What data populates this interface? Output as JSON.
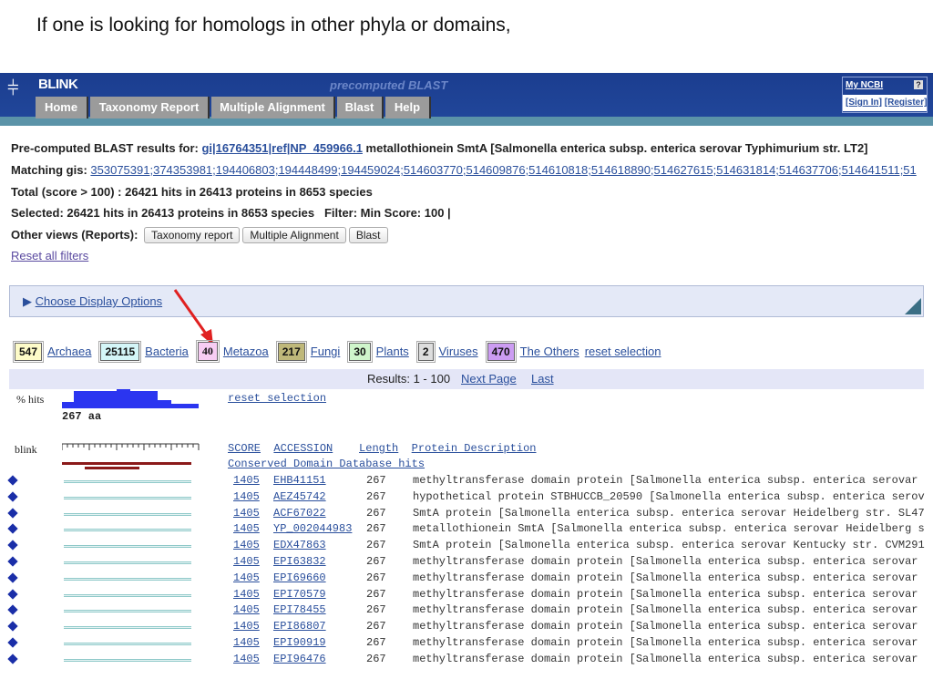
{
  "slide_title": "If one is looking for homologs in other phyla or domains,",
  "header": {
    "brand": "BLINK",
    "subtitle": "precomputed BLAST",
    "tabs": [
      "Home",
      "Taxonomy Report",
      "Multiple Alignment",
      "Blast",
      "Help"
    ],
    "my_ncbi": "My NCBI",
    "help_icon": "?",
    "sign_in": "[Sign In]",
    "register": "[Register]"
  },
  "summary": {
    "pre_label": "Pre-computed BLAST results for:",
    "query_link": "gi|16764351|ref|NP_459966.1",
    "query_desc": "metallothionein SmtA [Salmonella enterica subsp. enterica serovar Typhimurium str. LT2]",
    "matching_label": "Matching gis:",
    "matching_gis": "353075391;374353981;194406803;194448499;194459024;514603770;514609876;514610818;514618890;514627615;514631814;514637706;514641511;51",
    "total": "Total (score > 100) : 26421 hits in 26413 proteins in 8653 species",
    "selected": "Selected: 26421 hits in 26413 proteins in 8653 species   Filter: Min Score: 100 |",
    "other_views_label": "Other views (Reports):",
    "other_views": [
      "Taxonomy report",
      "Multiple Alignment",
      "Blast"
    ],
    "reset_filters": "Reset all filters"
  },
  "display_options": "Choose Display Options",
  "taxa": [
    {
      "count": "547",
      "name": "Archaea",
      "color": "#fdfbc8"
    },
    {
      "count": "25115",
      "name": "Bacteria",
      "color": "#d4f6f8"
    },
    {
      "count": "40",
      "name": "Metazoa",
      "color": "#f7cdf3"
    },
    {
      "count": "217",
      "name": "Fungi",
      "color": "#bfb87a"
    },
    {
      "count": "30",
      "name": "Plants",
      "color": "#cff5cb"
    },
    {
      "count": "2",
      "name": "Viruses",
      "color": "#dddddd"
    },
    {
      "count": "470",
      "name": "The Others",
      "color": "#cc9cf2"
    }
  ],
  "reset_selection": "reset selection",
  "results": {
    "range": "Results: 1 - 100",
    "next": "Next Page",
    "last": "Last"
  },
  "graph": {
    "hits_label": "% hits",
    "length": "267 aa",
    "blink_label": "blink"
  },
  "table": {
    "headers": [
      "SCORE",
      "ACCESSION",
      "Length",
      "Protein Description"
    ],
    "cdd": "Conserved Domain Database hits",
    "rows": [
      [
        "1405",
        "EHB41151",
        "267",
        "methyltransferase domain protein [Salmonella enterica subsp. enterica serovar"
      ],
      [
        "1405",
        "AEZ45742",
        "267",
        "hypothetical protein STBHUCCB_20590 [Salmonella enterica subsp. enterica serov"
      ],
      [
        "1405",
        "ACF67022",
        "267",
        "SmtA protein [Salmonella enterica subsp. enterica serovar Heidelberg str. SL47"
      ],
      [
        "1405",
        "YP_002044983",
        "267",
        "metallothionein SmtA [Salmonella enterica subsp. enterica serovar Heidelberg s"
      ],
      [
        "1405",
        "EDX47863",
        "267",
        "SmtA protein [Salmonella enterica subsp. enterica serovar Kentucky str. CVM291"
      ],
      [
        "1405",
        "EPI63832",
        "267",
        "methyltransferase domain protein [Salmonella enterica subsp. enterica serovar"
      ],
      [
        "1405",
        "EPI69660",
        "267",
        "methyltransferase domain protein [Salmonella enterica subsp. enterica serovar"
      ],
      [
        "1405",
        "EPI70579",
        "267",
        "methyltransferase domain protein [Salmonella enterica subsp. enterica serovar"
      ],
      [
        "1405",
        "EPI78455",
        "267",
        "methyltransferase domain protein [Salmonella enterica subsp. enterica serovar"
      ],
      [
        "1405",
        "EPI86807",
        "267",
        "methyltransferase domain protein [Salmonella enterica subsp. enterica serovar"
      ],
      [
        "1405",
        "EPI90919",
        "267",
        "methyltransferase domain protein [Salmonella enterica subsp. enterica serovar"
      ],
      [
        "1405",
        "EPI96476",
        "267",
        "methyltransferase domain protein [Salmonella enterica subsp. enterica serovar"
      ]
    ]
  }
}
